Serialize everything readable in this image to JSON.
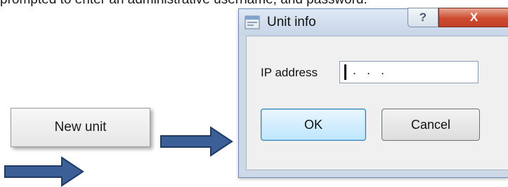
{
  "caption": {
    "top_text": "prompted to enter an administrative username, and password."
  },
  "new_unit_button": {
    "label": "New unit"
  },
  "dialog": {
    "title": "Unit info",
    "help_label": "?",
    "close_label": "X",
    "ip_label": "IP address",
    "ip_value": ".   .   .",
    "ok_label": "OK",
    "cancel_label": "Cancel"
  },
  "icons": {
    "app": "window-icon",
    "arrow": "right-arrow-icon"
  },
  "colors": {
    "arrow_fill": "#3b5f96",
    "arrow_outline": "#1f3a63",
    "close_red": "#c94528",
    "ok_border": "#3c7fb1"
  }
}
